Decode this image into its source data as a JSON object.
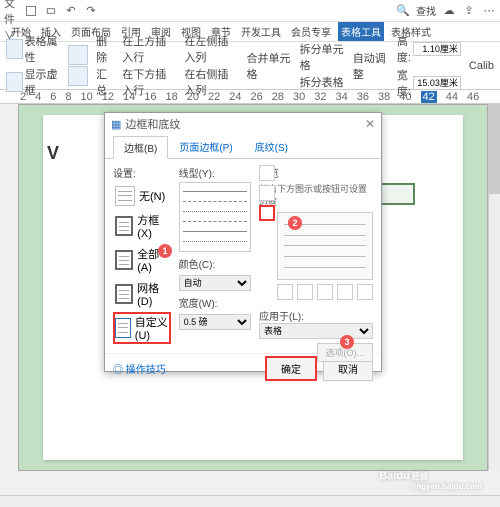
{
  "topbar": {
    "menu": "三 文件 ∨",
    "search_placeholder": "查找"
  },
  "tabs": [
    "开始",
    "插入",
    "页面布局",
    "引用",
    "审阅",
    "视图",
    "章节",
    "开发工具",
    "会员专享",
    "表格工具",
    "表格样式"
  ],
  "active_tab": "表格工具",
  "ribbon": {
    "g1a": "表格属性",
    "g1b": "显示虚框",
    "g2": "绘制表格",
    "g3": "擦除",
    "g4a": "删除",
    "g4b": "汇总",
    "g5a": "在上方插入行",
    "g5b": "在下方插入行",
    "g6a": "在左侧插入列",
    "g6b": "在右侧插入列",
    "g7": "合并单元格",
    "g8": "拆分单元格",
    "g9": "拆分表格",
    "g10": "自动调整",
    "h_label": "高度:",
    "h_val": "1.10厘米",
    "w_label": "宽度:",
    "w_val": "15.03厘米",
    "font": "Calib"
  },
  "ruler_marks": [
    "2",
    "4",
    "6",
    "8",
    "10",
    "12",
    "14",
    "16",
    "18",
    "20",
    "22",
    "24",
    "26",
    "28",
    "30",
    "32",
    "34",
    "36",
    "38",
    "40",
    "42",
    "44",
    "46"
  ],
  "doc": {
    "letter": "V"
  },
  "dialog": {
    "title": "边框和底纹",
    "tabs": {
      "t1": "边框(B)",
      "t2": "页面边框(P)",
      "t3": "底纹(S)"
    },
    "settings_label": "设置:",
    "presets": {
      "none": "无(N)",
      "box": "方框(X)",
      "all": "全部(A)",
      "grid": "网格(D)",
      "custom": "自定义(U)"
    },
    "style_label": "线型(Y):",
    "color_label": "颜色(C):",
    "color_val": "自动",
    "width_label": "宽度(W):",
    "width_val": "0.5 磅",
    "preview_label": "预览",
    "preview_hint": "单击下方图示或按钮可设置边框",
    "apply_label": "应用于(L):",
    "apply_val": "表格",
    "options_btn": "选项(O)...",
    "tip": "◎ 操作技巧",
    "ok": "确定",
    "cancel": "取消"
  },
  "badges": {
    "b1": "1",
    "b2": "2",
    "b3": "3"
  },
  "watermark": {
    "brand": "Baidu",
    "sub1": "经验",
    "sub2": "jingyan.baidu.com"
  }
}
